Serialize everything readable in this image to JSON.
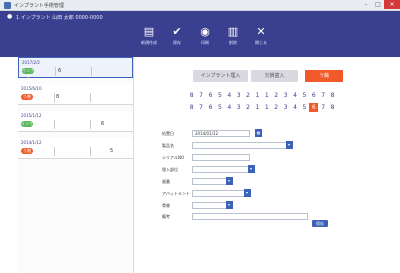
{
  "window": {
    "title": "インプラント手術管理"
  },
  "header": {
    "info": "1 インプラント 山田 太郎 0000-0000"
  },
  "toolbar": [
    {
      "label": "新規作成",
      "icon": "document-icon",
      "glyph": "▤"
    },
    {
      "label": "保存",
      "icon": "check-circle-icon",
      "glyph": "✔"
    },
    {
      "label": "印刷",
      "icon": "camera-icon",
      "glyph": "◉"
    },
    {
      "label": "削除",
      "icon": "trash-icon",
      "glyph": "▥"
    },
    {
      "label": "閉じる",
      "icon": "close-x-icon",
      "glyph": "✕"
    }
  ],
  "sidebar": {
    "cards": [
      {
        "date": "2017/2/2",
        "badge": "インプラ",
        "badge_color": "#5cb85c",
        "value": "6",
        "selected": true
      },
      {
        "date": "2015/6/10",
        "badge": "う蝕",
        "badge_color": "#f05a28",
        "value": "8"
      },
      {
        "date": "2015/1/12",
        "badge": "インプラ",
        "badge_color": "#5cb85c",
        "value": "6"
      },
      {
        "date": "2014/1/12",
        "badge": "う蝕",
        "badge_color": "#f05a28",
        "value": "5"
      }
    ]
  },
  "segments": {
    "implant": "インプラント埋入",
    "missing": "欠損歯入",
    "cavity": "う蝕"
  },
  "teeth": {
    "upper": [
      "8",
      "7",
      "6",
      "5",
      "4",
      "3",
      "2",
      "1",
      "1",
      "2",
      "3",
      "4",
      "5",
      "6",
      "7",
      "8"
    ],
    "lower": [
      "8",
      "7",
      "6",
      "5",
      "4",
      "3",
      "2",
      "1",
      "1",
      "2",
      "3",
      "4",
      "5",
      "6",
      "7",
      "8"
    ],
    "highlight_lower_index": 13
  },
  "form": {
    "date_label": "処置日",
    "date_value": "2014/01/12",
    "label2": "製品名",
    "label3": "シリアルNO",
    "label4": "埋入部位",
    "label5": "歯番",
    "label6": "アバットメント",
    "label7": "骨質",
    "label8": "備考",
    "save": "保存"
  },
  "colors": {
    "header": "#3b3f8f",
    "accent": "#3b62b8",
    "cavity": "#f05a28",
    "implant": "#5cb85c"
  }
}
